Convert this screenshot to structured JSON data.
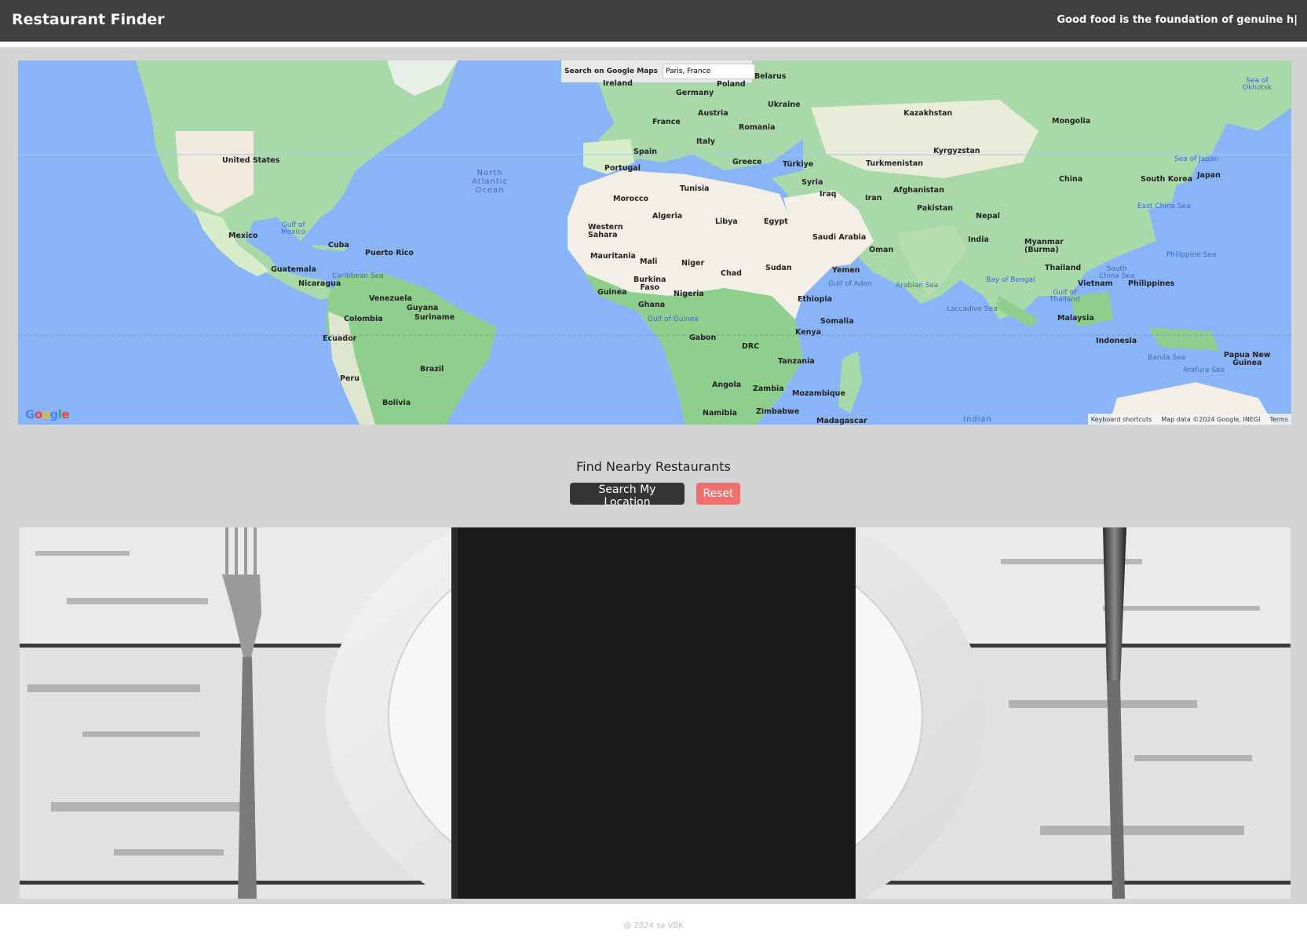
{
  "header": {
    "title": "Restaurant Finder",
    "tagline": "Good food is the foundation of genuine h|"
  },
  "map": {
    "search_label": "Search on Google Maps",
    "search_value": "Paris, France",
    "logo_text": "Google",
    "footer": {
      "shortcuts": "Keyboard shortcuts",
      "attribution": "Map data ©2024 Google, INEGI",
      "terms": "Terms"
    },
    "labels": {
      "united_states": "United States",
      "mexico": "Mexico",
      "cuba": "Cuba",
      "puerto_rico": "Puerto Rico",
      "guatemala": "Guatemala",
      "nicaragua": "Nicaragua",
      "venezuela": "Venezuela",
      "colombia": "Colombia",
      "ecuador": "Ecuador",
      "peru": "Peru",
      "brazil": "Brazil",
      "bolivia": "Bolivia",
      "guyana": "Guyana",
      "suriname": "Suriname",
      "ireland": "Ireland",
      "poland": "Poland",
      "belarus": "Belarus",
      "germany": "Germany",
      "austria": "Austria",
      "ukraine": "Ukraine",
      "france": "France",
      "romania": "Romania",
      "italy": "Italy",
      "spain": "Spain",
      "portugal": "Portugal",
      "greece": "Greece",
      "turkiye": "Türkiye",
      "morocco": "Morocco",
      "tunisia": "Tunisia",
      "algeria": "Algeria",
      "libya": "Libya",
      "egypt": "Egypt",
      "western_sahara": "Western\nSahara",
      "mauritania": "Mauritania",
      "mali": "Mali",
      "niger": "Niger",
      "chad": "Chad",
      "sudan": "Sudan",
      "burkina_faso": "Burkina\nFaso",
      "guinea": "Guinea",
      "nigeria": "Nigeria",
      "ghana": "Ghana",
      "ethiopia": "Ethiopia",
      "somalia": "Somalia",
      "kenya": "Kenya",
      "gabon": "Gabon",
      "drc": "DRC",
      "tanzania": "Tanzania",
      "angola": "Angola",
      "zambia": "Zambia",
      "mozambique": "Mozambique",
      "namibia": "Namibia",
      "zimbabwe": "Zimbabwe",
      "madagascar": "Madagascar",
      "syria": "Syria",
      "iraq": "Iraq",
      "iran": "Iran",
      "saudi_arabia": "Saudi Arabia",
      "yemen": "Yemen",
      "oman": "Oman",
      "kazakhstan": "Kazakhstan",
      "mongolia": "Mongolia",
      "kyrgyzstan": "Kyrgyzstan",
      "turkmenistan": "Turkmenistan",
      "afghanistan": "Afghanistan",
      "pakistan": "Pakistan",
      "nepal": "Nepal",
      "india": "India",
      "china": "China",
      "south_korea": "South Korea",
      "japan": "Japan",
      "myanmar": "Myanmar\n(Burma)",
      "thailand": "Thailand",
      "vietnam": "Vietnam",
      "philippines": "Philippines",
      "malaysia": "Malaysia",
      "indonesia": "Indonesia",
      "papua_new_guinea": "Papua New\nGuinea",
      "north_atlantic": "North\nAtlantic\nOcean",
      "gulf_of_mexico": "Gulf of\nMexico",
      "caribbean_sea": "Caribbean Sea",
      "gulf_of_guinea": "Gulf of Guinea",
      "gulf_of_aden": "Gulf of Aden",
      "arabian_sea": "Arabian Sea",
      "bay_of_bengal": "Bay of Bengal",
      "laccadive_sea": "Laccadive Sea",
      "south_china_sea": "South\nChina Sea",
      "gulf_of_thailand": "Gulf of\nThailand",
      "east_china_sea": "East China Sea",
      "sea_of_japan": "Sea of Japan",
      "philippine_sea": "Philippine Sea",
      "sea_of_okhotsk": "Sea of\nOkhotsk",
      "banda_sea": "Banda Sea",
      "arafura_sea": "Arafura Sea",
      "indian": "Indian"
    }
  },
  "main": {
    "section_title": "Find Nearby Restaurants",
    "search_button": "Search My Location",
    "reset_button": "Reset"
  },
  "footer": {
    "copyright": "@ 2024 sa VBK"
  },
  "colors": {
    "header_bg": "#3f3f3f",
    "page_bg": "#d4d4d4",
    "ocean": "#8ab4f8",
    "land": "#b7dfb6",
    "desert": "#f3efe6",
    "search_button": "#353535",
    "reset_button": "#f07070"
  }
}
